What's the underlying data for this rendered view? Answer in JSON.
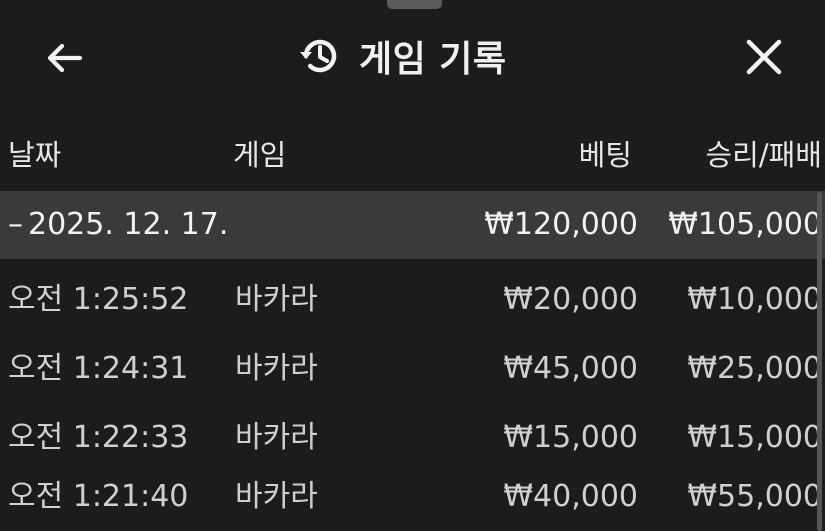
{
  "header": {
    "title": "게임 기록",
    "back_icon": "arrow-left-icon",
    "history_icon": "history-clock-icon",
    "close_icon": "close-icon"
  },
  "columns": {
    "date": "날짜",
    "game": "게임",
    "bet": "베팅",
    "result": "승리/패배"
  },
  "group": {
    "toggle": "–",
    "date": "2025. 12. 17.",
    "total_bet": "₩120,000",
    "total_result": "₩105,000"
  },
  "rows": [
    {
      "time": "오전 1:25:52",
      "game": "바카라",
      "bet": "₩20,000",
      "result": "₩10,000"
    },
    {
      "time": "오전 1:24:31",
      "game": "바카라",
      "bet": "₩45,000",
      "result": "₩25,000"
    },
    {
      "time": "오전 1:22:33",
      "game": "바카라",
      "bet": "₩15,000",
      "result": "₩15,000"
    },
    {
      "time": "오전 1:21:40",
      "game": "바카라",
      "bet": "₩40,000",
      "result": "₩55,000"
    }
  ],
  "colors": {
    "background": "#1c1c1c",
    "group_row": "#3a3a3a",
    "text": "#e9e9e9"
  }
}
